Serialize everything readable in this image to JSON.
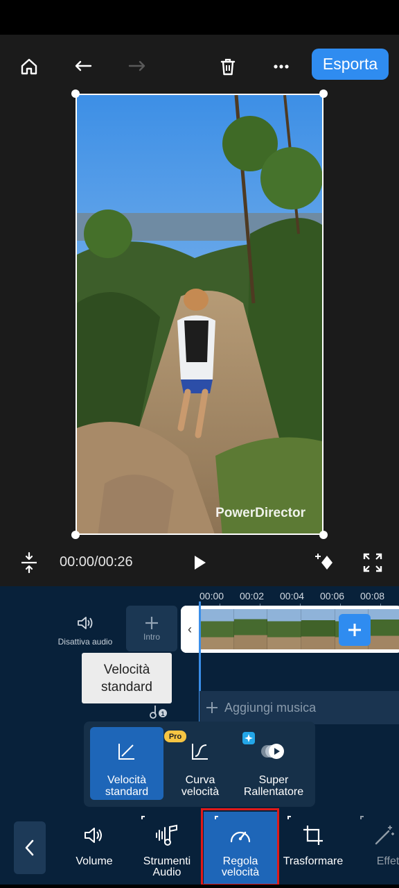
{
  "toolbar": {
    "export_label": "Esporta"
  },
  "preview": {
    "watermark": "PowerDirector"
  },
  "playback": {
    "timecode": "00:00/00:26"
  },
  "timeline": {
    "ruler": [
      "00:00",
      "00:02",
      "00:04",
      "00:06",
      "00:08"
    ],
    "mute_label": "Disattiva audio",
    "intro_label": "Intro",
    "add_music_label": "Aggiungi musica",
    "tooltip_line1": "Velocità",
    "tooltip_line2": "standard"
  },
  "speed_panel": {
    "options": [
      {
        "label1": "Velocità",
        "label2": "standard"
      },
      {
        "label1": "Curva",
        "label2": "velocità"
      },
      {
        "label1": "Super",
        "label2": "Rallentatore"
      }
    ],
    "pro_badge": "Pro"
  },
  "bottom_tools": [
    {
      "label1": "Volume",
      "label2": ""
    },
    {
      "label1": "Strumenti",
      "label2": "Audio"
    },
    {
      "label1": "Regola",
      "label2": "velocità"
    },
    {
      "label1": "Trasformare",
      "label2": ""
    },
    {
      "label1": "Effet",
      "label2": ""
    }
  ],
  "colors": {
    "accent": "#2f8cf0",
    "panel": "#08213a",
    "active": "#1e66b8",
    "highlight": "#e01a1a",
    "pro": "#f6c543"
  }
}
